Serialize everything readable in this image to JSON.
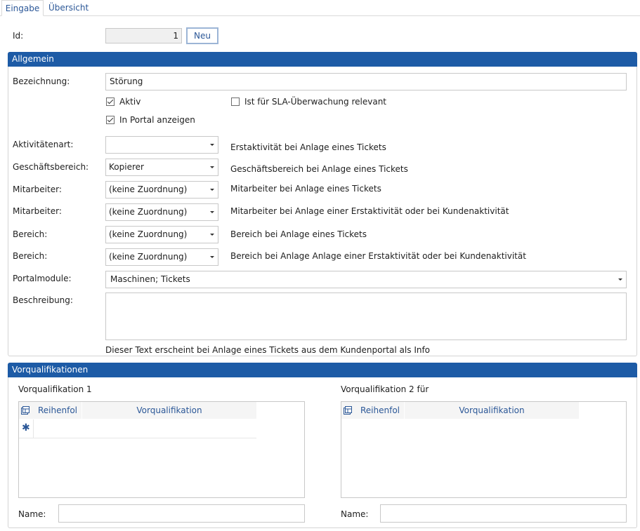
{
  "tabs": [
    {
      "label": "Eingabe",
      "active": true
    },
    {
      "label": "Übersicht",
      "active": false
    }
  ],
  "id_field": {
    "label": "Id:",
    "value": "1",
    "new_button": "Neu"
  },
  "allgemein": {
    "header": "Allgemein",
    "bezeichnung_label": "Bezeichnung:",
    "bezeichnung_value": "Störung",
    "aktiv_label": "Aktiv",
    "aktiv_checked": true,
    "sla_label": "Ist für SLA-Überwachung relevant",
    "sla_checked": false,
    "portal_label": "In Portal anzeigen",
    "portal_checked": true,
    "rows": [
      {
        "label": "Aktivitätenart:",
        "value": "",
        "hint": "Erstaktivität bei Anlage eines Tickets"
      },
      {
        "label": "Geschäftsbereich:",
        "value": "Kopierer",
        "hint": "Geschäftsbereich bei Anlage eines Tickets"
      },
      {
        "label": "Mitarbeiter:",
        "value": "(keine Zuordnung)",
        "hint": "Mitarbeiter bei Anlage eines Tickets"
      },
      {
        "label": "Mitarbeiter:",
        "value": "(keine Zuordnung)",
        "hint": "Mitarbeiter bei Anlage einer Erstaktivität oder bei Kundenaktivität"
      },
      {
        "label": "Bereich:",
        "value": "(keine Zuordnung)",
        "hint": "Bereich bei Anlage eines Tickets"
      },
      {
        "label": "Bereich:",
        "value": "(keine Zuordnung)",
        "hint": "Bereich bei Anlage Anlage einer Erstaktivität oder bei Kundenaktivität"
      }
    ],
    "portalmodule_label": "Portalmodule:",
    "portalmodule_value": "Maschinen; Tickets",
    "beschreibung_label": "Beschreibung:",
    "beschreibung_value": "",
    "beschreibung_hint": "Dieser Text erscheint bei Anlage eines Tickets aus dem Kundenportal als Info"
  },
  "vorqualifikationen": {
    "header": "Vorqualifikationen",
    "left": {
      "title": "Vorqualifikation 1",
      "col1": "Reihenfol",
      "col2": "Vorqualifikation",
      "name_label": "Name:",
      "name_value": ""
    },
    "right": {
      "title": "Vorqualifikation 2 für",
      "col1": "Reihenfol",
      "col2": "Vorqualifikation",
      "name_label": "Name:",
      "name_value": ""
    }
  },
  "colors": {
    "accent": "#1d5ba6",
    "link": "#2b5797"
  },
  "icons": {
    "grid_icon": "grid-columns-icon",
    "new_row_icon": "asterisk-icon",
    "dropdown_icon": "chevron-down-icon",
    "checkmark": "checkmark-icon"
  }
}
